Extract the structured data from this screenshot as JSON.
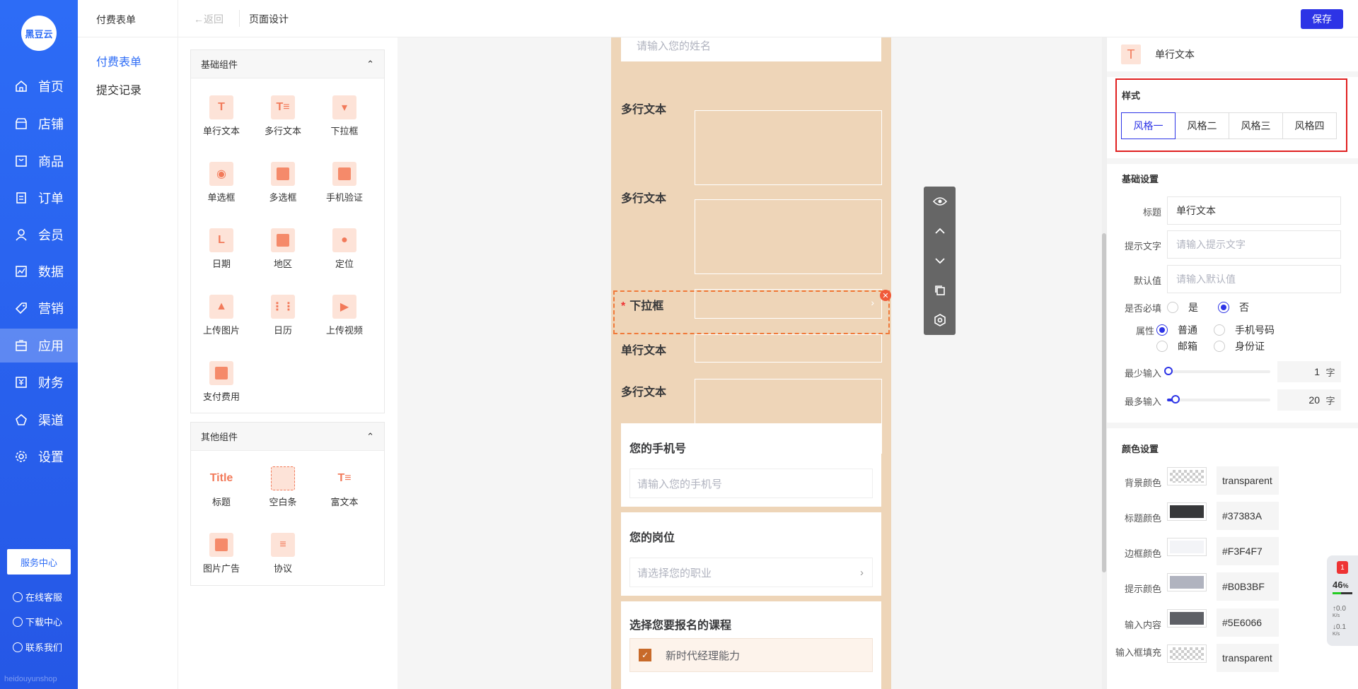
{
  "nav": {
    "logo": "黑豆云",
    "items": [
      {
        "label": "首页",
        "icon": "home-icon"
      },
      {
        "label": "店铺",
        "icon": "store-icon"
      },
      {
        "label": "商品",
        "icon": "goods-icon"
      },
      {
        "label": "订单",
        "icon": "order-icon"
      },
      {
        "label": "会员",
        "icon": "user-icon"
      },
      {
        "label": "数据",
        "icon": "chart-icon"
      },
      {
        "label": "营销",
        "icon": "tag-icon"
      },
      {
        "label": "应用",
        "icon": "app-icon"
      },
      {
        "label": "财务",
        "icon": "finance-icon"
      },
      {
        "label": "渠道",
        "icon": "channel-icon"
      },
      {
        "label": "设置",
        "icon": "gear-icon"
      }
    ],
    "active": "应用",
    "service_btn": "服务中心",
    "online_service": "在线客服",
    "download_center": "下载中心",
    "contact_us": "联系我们",
    "footer": "heidouyunshop"
  },
  "subnav": {
    "title": "付费表单",
    "items": [
      "付费表单",
      "提交记录"
    ]
  },
  "topbar": {
    "back": "←返回",
    "title": "页面设计",
    "save": "保存"
  },
  "components": {
    "basic_title": "基础组件",
    "basic": [
      "单行文本",
      "多行文本",
      "下拉框",
      "单选框",
      "多选框",
      "手机验证",
      "日期",
      "地区",
      "定位",
      "上传图片",
      "日历",
      "上传视频",
      "支付费用"
    ],
    "other_title": "其他组件",
    "other": [
      "标题",
      "空白条",
      "富文本",
      "图片广告",
      "协议"
    ],
    "title_icon_text": "Title"
  },
  "form": {
    "top_placeholder": "请输入您的姓名",
    "rows": [
      {
        "label": "多行文本"
      },
      {
        "label": "多行文本"
      },
      {
        "label": "下拉框",
        "required": "*"
      },
      {
        "label": "单行文本"
      },
      {
        "label": "多行文本"
      }
    ],
    "phone_title": "您的手机号",
    "phone_placeholder": "请输入您的手机号",
    "job_title": "您的岗位",
    "job_placeholder": "请选择您的职业",
    "course_title": "选择您要报名的课程",
    "course_option": "新时代经理能力"
  },
  "settings": {
    "header": "单行文本",
    "style_title": "样式",
    "styles": [
      "风格一",
      "风格二",
      "风格三",
      "风格四"
    ],
    "active_style": 0,
    "basic_title": "基础设置",
    "title_label": "标题",
    "title_value": "单行文本",
    "hint_label": "提示文字",
    "hint_placeholder": "请输入提示文字",
    "default_label": "默认值",
    "default_placeholder": "请输入默认值",
    "required_label": "是否必填",
    "yes": "是",
    "no": "否",
    "attr_label": "属性",
    "attr_normal": "普通",
    "attr_phone": "手机号码",
    "attr_email": "邮箱",
    "attr_id": "身份证",
    "min_label": "最少输入",
    "min_value": "1",
    "max_label": "最多输入",
    "max_value": "20",
    "unit": "字",
    "color_title": "颜色设置",
    "colors": [
      {
        "label": "背景颜色",
        "value": "transparent",
        "swatch": "transparent"
      },
      {
        "label": "标题颜色",
        "value": "#37383A",
        "swatch": "#37383A"
      },
      {
        "label": "边框颜色",
        "value": "#F3F4F7",
        "swatch": "#F3F4F7"
      },
      {
        "label": "提示颜色",
        "value": "#B0B3BF",
        "swatch": "#B0B3BF"
      },
      {
        "label": "输入内容",
        "value": "#5E6066",
        "swatch": "#5E6066"
      },
      {
        "label": "输入框填充",
        "value": "transparent",
        "swatch": "transparent"
      }
    ]
  },
  "widget": {
    "badge": "1",
    "percent": "46",
    "pct_unit": "%",
    "up": "0.0",
    "down": "0.1",
    "speed_unit": "K/s"
  }
}
